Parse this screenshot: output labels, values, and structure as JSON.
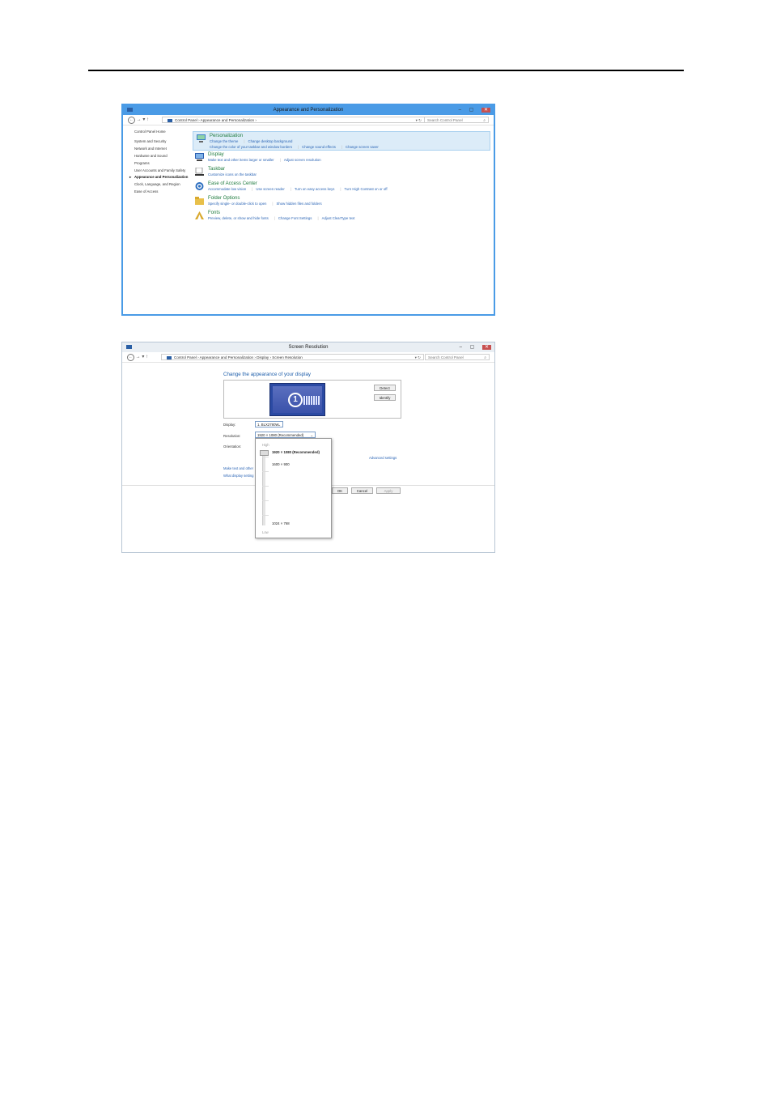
{
  "window1": {
    "title": "Appearance and Personalization",
    "controls": "–  ▢",
    "close": "✕",
    "breadcrumb": "Control Panel  ›  Appearance and Personalization  ›",
    "search_placeholder": "Search Control Panel",
    "sidebar": [
      "Control Panel Home",
      "System and Security",
      "Network and Internet",
      "Hardware and Sound",
      "Programs",
      "User Accounts and Family Safety",
      "Appearance and Personalization",
      "Clock, Language, and Region",
      "Ease of Access"
    ],
    "categories": [
      {
        "title": "Personalization",
        "icon": "personalization-icon",
        "links_row1": [
          "Change the theme",
          "Change desktop background"
        ],
        "links_row2": [
          "Change the color of your taskbar and window borders",
          "Change sound effects",
          "Change screen saver"
        ]
      },
      {
        "title": "Display",
        "icon": "display-icon",
        "links_row1": [
          "Make text and other items larger or smaller",
          "Adjust screen resolution"
        ]
      },
      {
        "title": "Taskbar",
        "icon": "taskbar-icon",
        "links_row1": [
          "Customize icons on the taskbar"
        ]
      },
      {
        "title": "Ease of Access Center",
        "icon": "ease-of-access-icon",
        "links_row1": [
          "Accommodate low vision",
          "Use screen reader",
          "Turn on easy access keys",
          "Turn High Contrast on or off"
        ]
      },
      {
        "title": "Folder Options",
        "icon": "folder-icon",
        "links_row1": [
          "Specify single- or double-click to open",
          "Show hidden files and folders"
        ]
      },
      {
        "title": "Fonts",
        "icon": "fonts-icon",
        "links_row1": [
          "Preview, delete, or show and hide fonts",
          "Change Font Settings",
          "Adjust ClearType text"
        ]
      }
    ]
  },
  "window2": {
    "title": "Screen Resolution",
    "controls": "–  ▢",
    "close": "✕",
    "breadcrumb": "Control Panel  ›  Appearance and Personalization  ›  Display  ›  Screen Resolution",
    "search_placeholder": "Search Control Panel",
    "heading": "Change the appearance of your display",
    "monitor_number": "1",
    "detect": "Detect",
    "identify": "Identify",
    "display_label": "Display:",
    "display_value": "1. BLX2780W",
    "resolution_label": "Resolution:",
    "resolution_value": "1920 × 1080 (Recommended)",
    "orientation_label": "Orientation:",
    "advanced_settings": "Advanced settings",
    "link_make_text": "Make text and other",
    "link_what_display": "What display setting",
    "ok": "OK",
    "cancel": "Cancel",
    "apply": "Apply",
    "slider": {
      "high": "High",
      "low": "Low",
      "options": [
        "1920 × 1080 (Recommended)",
        "1600 × 900",
        "1024 × 768"
      ]
    }
  }
}
